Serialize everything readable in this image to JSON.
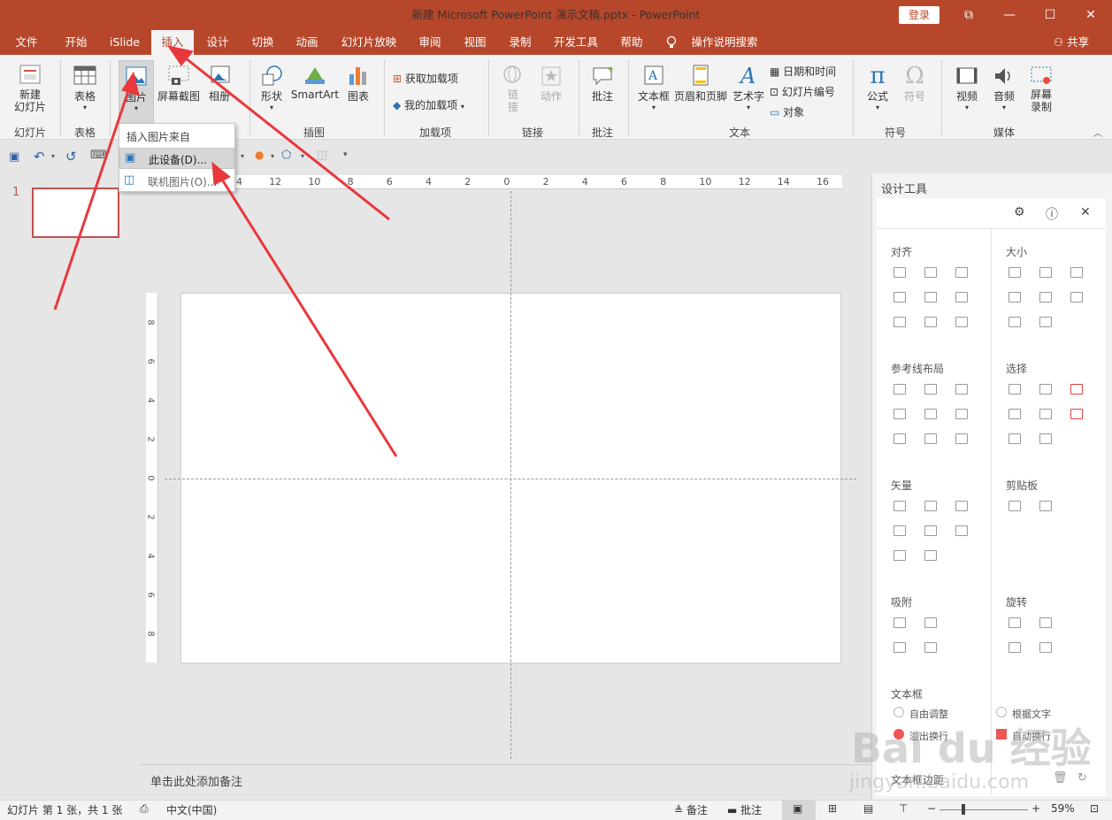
{
  "window": {
    "title": "新建 Microsoft PowerPoint 演示文稿.pptx  -  PowerPoint",
    "login": "登录",
    "controls": [
      "⧉",
      "—",
      "☐",
      "✕"
    ]
  },
  "tabs": [
    "文件",
    "开始",
    "iSlide",
    "插入",
    "设计",
    "切换",
    "动画",
    "幻灯片放映",
    "审阅",
    "视图",
    "录制",
    "开发工具",
    "帮助",
    "操作说明搜索"
  ],
  "share": "共享",
  "ribbon": {
    "new_slide": "新建\n幻灯片",
    "table": "表格",
    "picture": "图片",
    "screenshot": "屏幕截图",
    "album": "相册",
    "shapes": "形状",
    "smartart": "SmartArt",
    "chart": "图表",
    "get_addins": "获取加载项",
    "my_addins": "我的加载项",
    "link": "链\n接",
    "action": "动作",
    "comment": "批注",
    "textbox": "文本框",
    "header_footer": "页眉和页脚",
    "wordart": "艺术字",
    "date_time": "日期和时间",
    "slide_number": "幻灯片编号",
    "object": "对象",
    "equation": "公式",
    "symbol": "符号",
    "video": "视频",
    "audio": "音频",
    "screen_record": "屏幕\n录制",
    "groups": {
      "slides": "幻灯片",
      "tables": "表格",
      "illustrations": "插图",
      "addins": "加载项",
      "links": "链接",
      "comments": "批注",
      "text": "文本",
      "symbols": "符号",
      "media": "媒体"
    }
  },
  "dropdown": {
    "header": "插入图片来自",
    "items": [
      "此设备(D)...",
      "联机图片(O)..."
    ]
  },
  "ruler": {
    "h_labels": [
      "14",
      "12",
      "10",
      "8",
      "6",
      "4",
      "2",
      "0",
      "2",
      "4",
      "6",
      "8",
      "10",
      "12",
      "14",
      "16"
    ],
    "v_labels": [
      "8",
      "6",
      "4",
      "2",
      "0",
      "2",
      "4",
      "6",
      "8"
    ]
  },
  "slide_number": "1",
  "notes_placeholder": "单击此处添加备注",
  "panel": {
    "title": "设计工具",
    "sections": [
      "对齐",
      "大小",
      "参考线布局",
      "选择",
      "矢量",
      "剪贴板",
      "吸附",
      "旋转",
      "文本框"
    ],
    "textbox_options": [
      "自由调整",
      "根据文字",
      "溢出换行",
      "自动换行"
    ],
    "margin_label": "文本框边距"
  },
  "status": {
    "slide_info": "幻灯片 第 1 张，共 1 张",
    "language": "中文(中国)",
    "notes": "备注",
    "comments": "批注",
    "zoom": "59%"
  },
  "watermark": {
    "logo": "Bai du 经验",
    "url": "jingyan.baidu.com"
  },
  "colors": {
    "accent": "#b7472a",
    "arrow": "#e8383d"
  }
}
